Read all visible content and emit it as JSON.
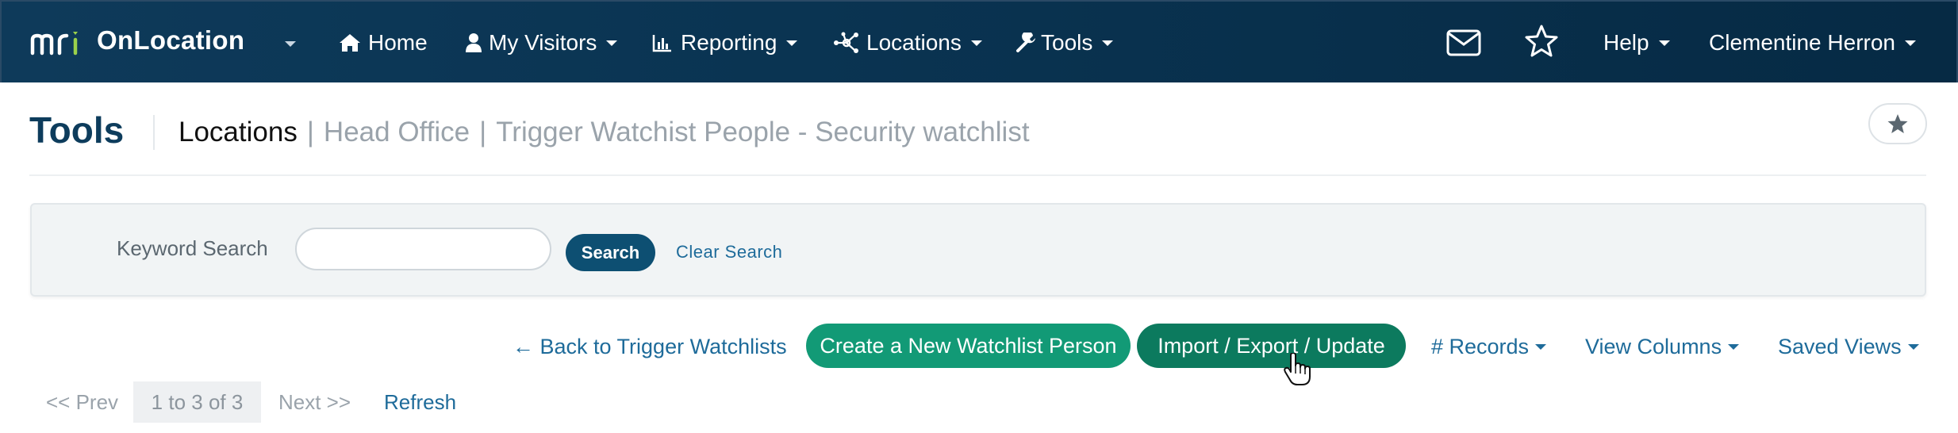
{
  "navbar": {
    "logo_text": "mri",
    "brand": "OnLocation",
    "items": [
      {
        "label": "Home",
        "icon": "home-icon"
      },
      {
        "label": "My Visitors",
        "icon": "user-icon"
      },
      {
        "label": "Reporting",
        "icon": "bar-chart-icon"
      },
      {
        "label": "Locations",
        "icon": "network-icon"
      },
      {
        "label": "Tools",
        "icon": "wrench-icon"
      }
    ],
    "mail_icon": "mail-icon",
    "star_icon": "star-icon",
    "help": "Help",
    "user": "Clementine Herron",
    "colors": {
      "bg_start": "#0e3a5a",
      "bg_end": "#062a44",
      "logo_accent": "#9bd14b"
    }
  },
  "header": {
    "title": "Tools",
    "breadcrumb": {
      "main": "Locations",
      "sep": "|",
      "parts": [
        "Head Office",
        "Trigger Watchist People - Security watchlist"
      ]
    },
    "favorite_icon": "star-icon"
  },
  "search": {
    "label": "Keyword Search",
    "value": "",
    "button": "Search",
    "clear": "Clear Search"
  },
  "actions": {
    "back": "← Back to Trigger Watchlists",
    "create": "Create a New Watchlist Person",
    "import": "Import / Export / Update",
    "records": "# Records",
    "view_columns": "View Columns",
    "saved_views": "Saved Views",
    "colors": {
      "create": "#129a76",
      "import": "#0c7a5e",
      "link": "#1e6b9a"
    }
  },
  "pagination": {
    "prev": "<< Prev",
    "range": "1 to 3 of 3",
    "next": "Next >>",
    "refresh": "Refresh"
  }
}
